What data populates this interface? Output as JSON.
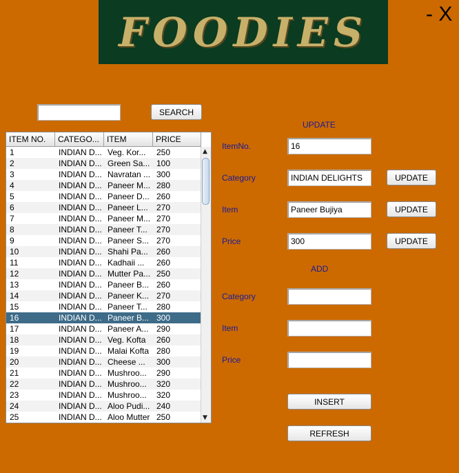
{
  "app": {
    "banner_title": "FOODIES",
    "window_controls": "- X"
  },
  "search": {
    "value": "",
    "button_label": "SEARCH"
  },
  "table": {
    "headers": [
      "ITEM NO.",
      "CATEGO...",
      "ITEM",
      "PRICE"
    ],
    "rows": [
      [
        "1",
        "INDIAN D...",
        "Veg. Kor...",
        "250"
      ],
      [
        "2",
        "INDIAN D...",
        "Green Sa...",
        "100"
      ],
      [
        "3",
        "INDIAN D...",
        "Navratan ...",
        "300"
      ],
      [
        "4",
        "INDIAN D...",
        "Paneer M...",
        "280"
      ],
      [
        "5",
        "INDIAN D...",
        "Paneer D...",
        "260"
      ],
      [
        "6",
        "INDIAN D...",
        "Paneer L...",
        "270"
      ],
      [
        "7",
        "INDIAN D...",
        "Paneer M...",
        "270"
      ],
      [
        "8",
        "INDIAN D...",
        "Paneer T...",
        "270"
      ],
      [
        "9",
        "INDIAN D...",
        "Paneer S...",
        "270"
      ],
      [
        "10",
        "INDIAN D...",
        "Shahi Pa...",
        "260"
      ],
      [
        "11",
        "INDIAN D...",
        "Kadhaii ...",
        "260"
      ],
      [
        "12",
        "INDIAN D...",
        "Mutter Pa...",
        "250"
      ],
      [
        "13",
        "INDIAN D...",
        "Paneer B...",
        "260"
      ],
      [
        "14",
        "INDIAN D...",
        "Paneer K...",
        "270"
      ],
      [
        "15",
        "INDIAN D...",
        "Paneer T...",
        "280"
      ],
      [
        "16",
        "INDIAN D...",
        "Paneer B...",
        "300"
      ],
      [
        "17",
        "INDIAN D...",
        "Paneer A...",
        "290"
      ],
      [
        "18",
        "INDIAN D...",
        "Veg. Kofta",
        "260"
      ],
      [
        "19",
        "INDIAN D...",
        "Malai Kofta",
        "280"
      ],
      [
        "20",
        "INDIAN D...",
        "Cheese ...",
        "300"
      ],
      [
        "21",
        "INDIAN D...",
        "Mushroo...",
        "290"
      ],
      [
        "22",
        "INDIAN D...",
        "Mushroo...",
        "320"
      ],
      [
        "23",
        "INDIAN D...",
        "Mushroo...",
        "320"
      ],
      [
        "24",
        "INDIAN D...",
        "Aloo Pudi...",
        "240"
      ],
      [
        "25",
        "INDIAN D...",
        "Aloo Mutter",
        "250"
      ]
    ],
    "selected_row": 15
  },
  "update": {
    "title": "UPDATE",
    "itemno_label": "ItemNo.",
    "itemno_value": "16",
    "category_label": "Category",
    "category_value": "INDIAN DELIGHTS",
    "item_label": "Item",
    "item_value": "Paneer Bujiya",
    "price_label": "Price",
    "price_value": "300",
    "button_label": "UPDATE"
  },
  "add": {
    "title": "ADD",
    "category_label": "Category",
    "category_value": "",
    "item_label": "Item",
    "item_value": "",
    "price_label": "Price",
    "price_value": "",
    "insert_label": "INSERT",
    "refresh_label": "REFRESH"
  }
}
